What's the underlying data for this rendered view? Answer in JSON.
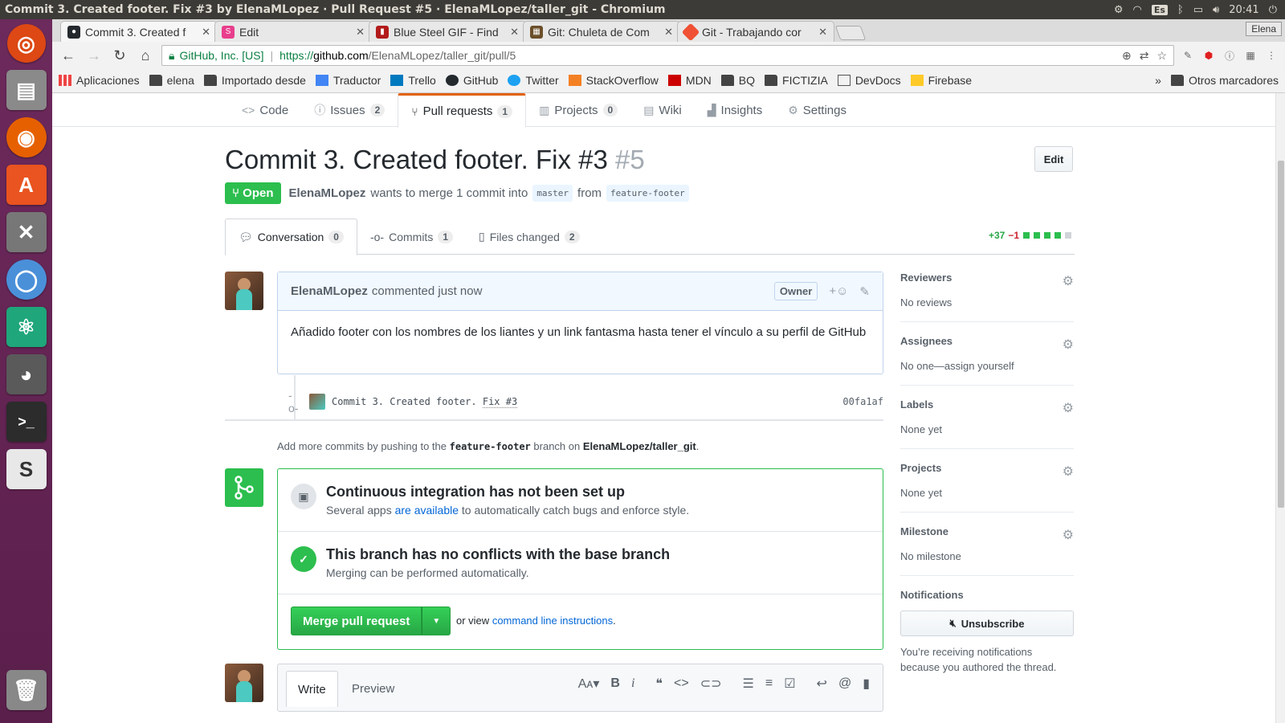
{
  "window_title": "Commit 3. Created footer. Fix #3 by ElenaMLopez · Pull Request #5 · ElenaMLopez/taller_git - Chromium",
  "tray": {
    "keyboard": "Es",
    "clock": "20:41"
  },
  "browser": {
    "tabs": [
      {
        "label": "Commit 3. Created f",
        "color": "#24292e"
      },
      {
        "label": "Edit",
        "color": "#e83e8c"
      },
      {
        "label": "Blue Steel GIF - Find",
        "color": "#b31b1b"
      },
      {
        "label": "Git: Chuleta de Com",
        "color": "#6b4f2a"
      },
      {
        "label": "Git - Trabajando cor",
        "color": "#f05033"
      }
    ],
    "user": "Elena",
    "url": {
      "secure": "GitHub, Inc. [US]",
      "scheme": "https://",
      "host": "github.com",
      "path": "/ElenaMLopez/taller_git/pull/5"
    },
    "bookmarks": [
      "Aplicaciones",
      "elena",
      "Importado desde",
      "Traductor",
      "Trello",
      "GitHub",
      "Twitter",
      "StackOverflow",
      "MDN",
      "BQ",
      "FICTIZIA",
      "DevDocs",
      "Firebase"
    ],
    "bookmarks_more": "»",
    "other_bookmarks": "Otros marcadores"
  },
  "repo_nav": [
    {
      "label": "Code",
      "count": ""
    },
    {
      "label": "Issues",
      "count": "2"
    },
    {
      "label": "Pull requests",
      "count": "1"
    },
    {
      "label": "Projects",
      "count": "0"
    },
    {
      "label": "Wiki",
      "count": ""
    },
    {
      "label": "Insights",
      "count": ""
    },
    {
      "label": "Settings",
      "count": ""
    }
  ],
  "pr": {
    "title": "Commit 3. Created footer. Fix #3",
    "number": "#5",
    "edit": "Edit",
    "state": "Open",
    "author": "ElenaMLopez",
    "merge_text": "wants to merge 1 commit into",
    "base": "master",
    "from": "from",
    "head": "feature-footer"
  },
  "pr_tabs": [
    {
      "label": "Conversation",
      "count": "0"
    },
    {
      "label": "Commits",
      "count": "1"
    },
    {
      "label": "Files changed",
      "count": "2"
    }
  ],
  "diffstat": {
    "additions": "+37",
    "deletions": "−1"
  },
  "comment": {
    "author": "ElenaMLopez",
    "when": "commented just now",
    "badge": "Owner",
    "body": "Añadido footer con los nombres de los liantes y un link fantasma hasta tener el vínculo a su perfil de GitHub"
  },
  "commit": {
    "message": "Commit 3. Created footer.",
    "issue": "Fix #3",
    "sha": "00fa1af"
  },
  "add_more": {
    "pre": "Add more commits by pushing to the",
    "branch": "feature-footer",
    "mid": "branch on",
    "repo": "ElenaMLopez/taller_git",
    "end": "."
  },
  "merge": {
    "ci_title": "Continuous integration has not been set up",
    "ci_pre": "Several apps",
    "ci_link": "are available",
    "ci_post": "to automatically catch bugs and enforce style.",
    "conflict_title": "This branch has no conflicts with the base branch",
    "conflict_sub": "Merging can be performed automatically.",
    "button": "Merge pull request",
    "or_view": "or view",
    "cli_link": "command line instructions",
    "cli_end": "."
  },
  "editor": {
    "write": "Write",
    "preview": "Preview"
  },
  "sidebar": {
    "reviewers": {
      "label": "Reviewers",
      "value": "No reviews"
    },
    "assignees": {
      "label": "Assignees",
      "value": "No one—assign yourself"
    },
    "labels": {
      "label": "Labels",
      "value": "None yet"
    },
    "projects": {
      "label": "Projects",
      "value": "None yet"
    },
    "milestone": {
      "label": "Milestone",
      "value": "No milestone"
    },
    "notifications": {
      "label": "Notifications",
      "button": "Unsubscribe",
      "note": "You’re receiving notifications because you authored the thread."
    }
  },
  "colors": {
    "open": "#2cbe4e",
    "link": "#0366d6",
    "add": "#28a745",
    "del": "#cb2431"
  }
}
